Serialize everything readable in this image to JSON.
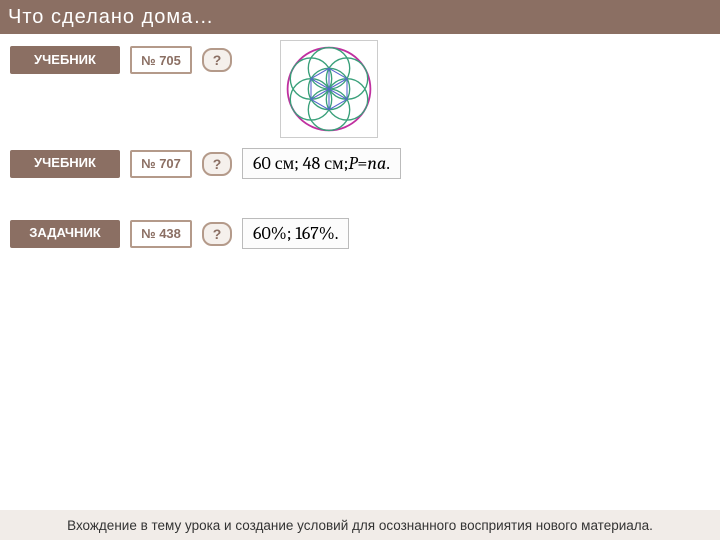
{
  "title": "Что  сделано  дома…",
  "rows": [
    {
      "tag": "УЧЕБНИК",
      "num": "№ 705",
      "q": "?",
      "answer": ""
    },
    {
      "tag": "УЧЕБНИК",
      "num": "№ 707",
      "q": "?",
      "answer_parts": {
        "a": "60 см;  48 см;  ",
        "var1": "P",
        "eq": " = ",
        "var2": "na",
        "tail": "."
      }
    },
    {
      "tag": "ЗАДАЧНИК",
      "num": "№ 438",
      "q": "?",
      "answer": "60%;  167%."
    }
  ],
  "footer": "Вхождение в тему урока и создание условий для осознанного восприятия нового материала."
}
